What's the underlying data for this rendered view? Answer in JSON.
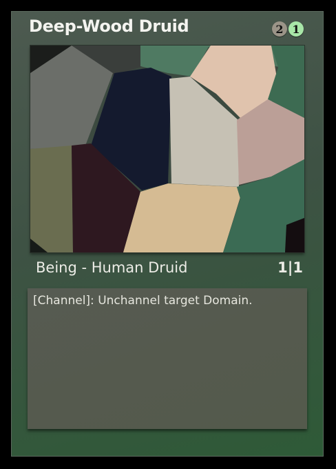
{
  "card": {
    "name": "Deep-Wood Druid",
    "mana_cost": [
      {
        "symbol": "2",
        "kind": "generic",
        "color": "#9b9488"
      },
      {
        "symbol": "1",
        "kind": "green",
        "color": "#a8e6a8"
      }
    ],
    "type_line": "Being - Human Druid",
    "power_toughness": "1|1",
    "rules_text": "[Channel]: Unchannel target Domain.",
    "frame_color": "#3e5244"
  }
}
